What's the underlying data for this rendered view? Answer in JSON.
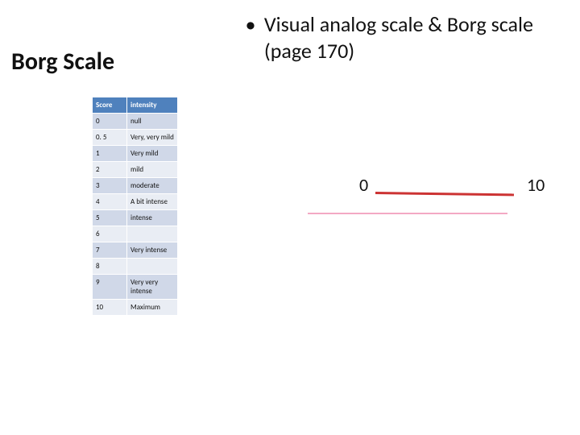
{
  "title_left": "Borg Scale",
  "bullet": {
    "marker": "•",
    "text": "Visual analog scale & Borg scale (page 170)"
  },
  "table": {
    "headers": [
      "Score",
      "intensity"
    ],
    "rows": [
      [
        "0",
        "null"
      ],
      [
        "0. 5",
        "Very, very  mild"
      ],
      [
        "1",
        "Very mild"
      ],
      [
        "2",
        "mild"
      ],
      [
        "3",
        "moderate"
      ],
      [
        "4",
        "A bit intense"
      ],
      [
        "5",
        "intense"
      ],
      [
        "6",
        ""
      ],
      [
        "7",
        "Very intense"
      ],
      [
        "8",
        ""
      ],
      [
        "9",
        "Very very intense"
      ],
      [
        "10",
        "Maximum"
      ]
    ]
  },
  "vas": {
    "left_label": "0",
    "right_label": "10"
  }
}
